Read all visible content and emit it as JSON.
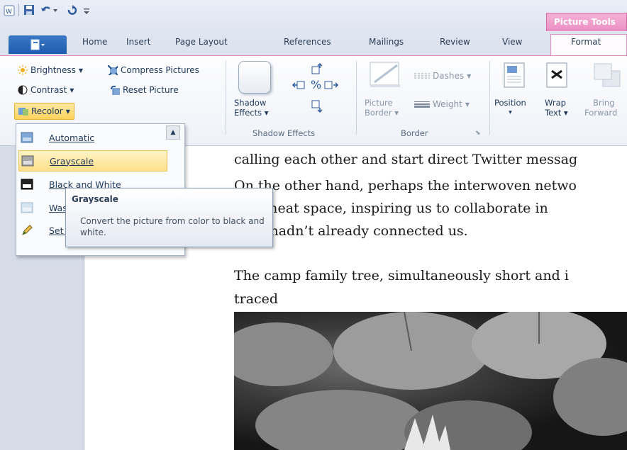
{
  "title_bar": {
    "contextual_tab": "Picture Tools"
  },
  "tabs": [
    "Home",
    "Insert",
    "Page Layout",
    "References",
    "Mailings",
    "Review",
    "View",
    "Format"
  ],
  "ribbon": {
    "adjust": {
      "brightness": "Brightness",
      "contrast": "Contrast",
      "recolor": "Recolor",
      "compress": "Compress Pictures",
      "reset": "Reset Picture"
    },
    "shadow": {
      "button_line1": "Shadow",
      "button_line2": "Effects",
      "group_label": "Shadow Effects"
    },
    "border": {
      "dashes": "Dashes",
      "picture_border_line1": "Picture",
      "picture_border_line2": "Border",
      "weight": "Weight",
      "group_label": "Border"
    },
    "arrange": {
      "position": "Position",
      "wrap_line1": "Wrap",
      "wrap_line2": "Text",
      "bring_line1": "Bring",
      "bring_line2": "Forward"
    }
  },
  "menu": {
    "items": [
      {
        "label": "Automatic",
        "icon": "automatic-icon"
      },
      {
        "label": "Grayscale",
        "icon": "grayscale-icon"
      },
      {
        "label": "Black and White",
        "icon": "black-white-icon"
      },
      {
        "label": "Washout",
        "icon": "washout-icon"
      },
      {
        "label": "Set Transparent Color",
        "icon": "pencil-icon"
      }
    ]
  },
  "tooltip": {
    "title": "Grayscale",
    "body": "Convert the picture from color to black and white."
  },
  "document": {
    "lines": [
      "calling each other and start direct Twitter messag",
      "On the other hand, perhaps the interwoven netwo",
      "into meat space, inspiring us to collaborate in",
      "sites hadn’t already connected us.",
      "The camp family tree, simultaneously short and i",
      "traced"
    ]
  },
  "colors": {
    "accent_pink": "#e889bf",
    "file_blue": "#1f5cae",
    "highlight_yellow": "#ffe08a"
  }
}
